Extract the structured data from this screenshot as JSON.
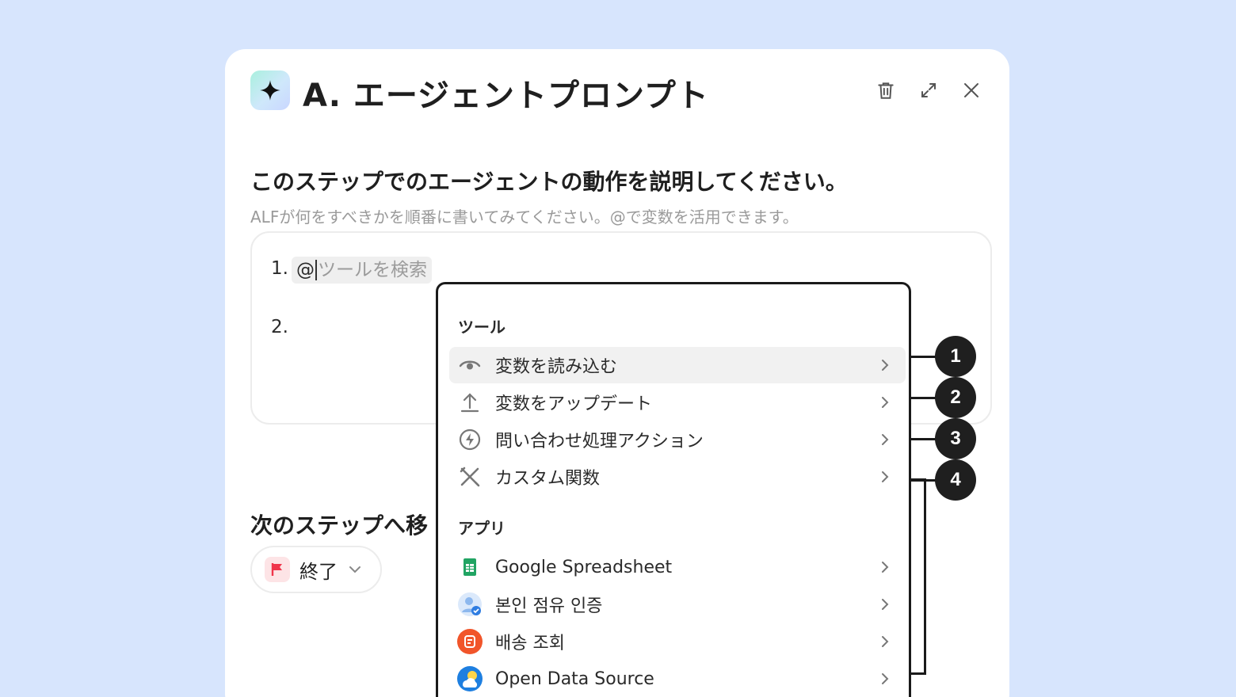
{
  "header": {
    "title": "A. エージェントプロンプト"
  },
  "instruction": {
    "title": "このステップでのエージェントの動作を説明してください。",
    "hint": "ALFが何をすべきかを順番に書いてみてください。@で変数を活用できます。"
  },
  "editor": {
    "lines": [
      "1.",
      "2."
    ],
    "mention_at": "@",
    "mention_placeholder": "ツールを検索"
  },
  "next_step": {
    "title": "次のステップへ移",
    "selected": "終了"
  },
  "menu": {
    "tools_group": "ツール",
    "tools": [
      {
        "label": "変数を読み込む",
        "icon": "eye-icon"
      },
      {
        "label": "変数をアップデート",
        "icon": "upload-icon"
      },
      {
        "label": "問い合わせ処理アクション",
        "icon": "lightning-icon"
      },
      {
        "label": "カスタム関数",
        "icon": "tools-icon"
      }
    ],
    "apps_group": "アプリ",
    "apps": [
      {
        "label": "Google Spreadsheet",
        "icon": "google-sheets-icon"
      },
      {
        "label": "본인 점유 인증",
        "icon": "user-verify-icon"
      },
      {
        "label": "배송 조회",
        "icon": "delivery-icon"
      },
      {
        "label": "Open Data Source",
        "icon": "weather-icon"
      }
    ]
  },
  "badges": [
    "1",
    "2",
    "3",
    "4"
  ],
  "colors": {
    "background": "#d7e5fd",
    "panel": "#ffffff",
    "badge": "#1f1f1f",
    "flag": "#f0354b"
  }
}
